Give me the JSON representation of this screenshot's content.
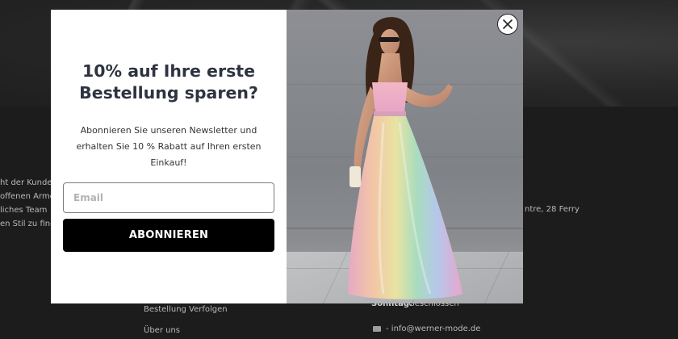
{
  "background": {
    "footer_left_lines": [
      "ht der Kunde",
      "offenen Arme",
      "liches Team",
      "en Stil zu find"
    ],
    "footer_links": [
      "Bestellung Verfolgen",
      "Über uns"
    ],
    "address_fragment": "ntre, 28 Ferry",
    "hours_label": "Sonntag:",
    "hours_value": "Geschlossen",
    "email_line": "- info@werner-mode.de"
  },
  "popup": {
    "headline": "10% auf Ihre erste\nBestellung sparen?",
    "subtext": "Abonnieren Sie unseren Newsletter und erhalten Sie 10 % Rabatt auf Ihren ersten Einkauf!",
    "email_placeholder": "Email",
    "email_value": "",
    "subscribe_label": "ABONNIEREN",
    "close_icon": "close-icon",
    "image_subject": "woman-in-rainbow-maxi-dress"
  },
  "colors": {
    "headline": "#2e3340",
    "button_bg": "#000000",
    "button_text": "#ffffff",
    "page_bg": "#1c1c1c"
  }
}
